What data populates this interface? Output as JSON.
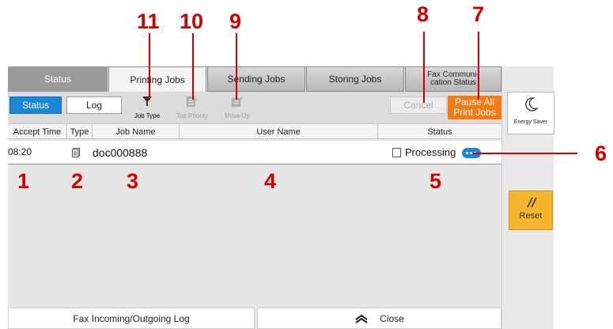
{
  "callouts": {
    "c1": "1",
    "c2": "2",
    "c3": "3",
    "c4": "4",
    "c5": "5",
    "c6": "6",
    "c7": "7",
    "c8": "8",
    "c9": "9",
    "c10": "10",
    "c11": "11"
  },
  "tabs": [
    {
      "label": "Status"
    },
    {
      "label": "Printing Jobs"
    },
    {
      "label": "Sending Jobs"
    },
    {
      "label": "Storing Jobs"
    },
    {
      "label": "Fax Communi-\ncation Status"
    }
  ],
  "toolbar": {
    "status_label": "Status",
    "log_label": "Log",
    "job_type_label": "Job Type",
    "top_priority_label": "Top Priority",
    "move_up_label": "Move Up",
    "cancel_label": "Cancel",
    "pause_all_label": "Pause All\nPrint Jobs"
  },
  "table": {
    "headers": [
      "Accept Time",
      "Type",
      "Job Name",
      "User Name",
      "Status"
    ],
    "rows": [
      {
        "accept_time": "08:20",
        "job_name": "doc000888",
        "user_name": "",
        "status": "Processing"
      }
    ]
  },
  "bottom": {
    "fax_log_label": "Fax Incoming/Outgoing Log",
    "close_label": "Close"
  },
  "side": {
    "energy_saver_label": "Energy Saver",
    "reset_label": "Reset"
  },
  "colors": {
    "callout": "#d10000",
    "accent_blue": "#1b86d6",
    "pause_orange": "#f47a14",
    "reset_yellow": "#f5b62d"
  },
  "icons": [
    "filter-icon",
    "top-priority-icon",
    "move-up-icon",
    "document-icon",
    "checkbox-icon",
    "more-icon",
    "moon-icon",
    "reset-icon",
    "chevron-up-icon"
  ]
}
